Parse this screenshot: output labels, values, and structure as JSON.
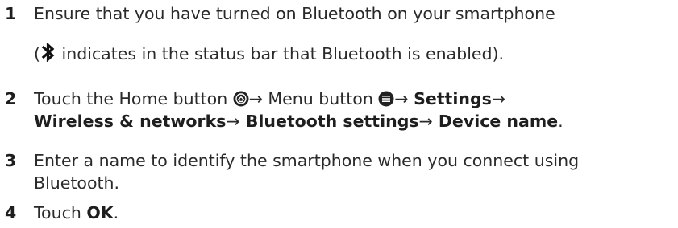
{
  "steps": [
    {
      "number": "1",
      "line1": "Ensure that you have turned on Bluetooth on your smartphone",
      "line2_open": "(",
      "line2_rest": " indicates in the status bar that Bluetooth is enabled)."
    },
    {
      "number": "2",
      "text_a": "Touch the Home button ",
      "arrow": "→",
      "text_b": " Menu button ",
      "settings": "Settings",
      "wireless": "Wireless & networks",
      "bt_settings": " Bluetooth settings",
      "device_name": " Device name",
      "period": "."
    },
    {
      "number": "3",
      "line1": "Enter a name to identify the smartphone when you connect using",
      "line2": "Bluetooth."
    },
    {
      "number": "4",
      "text": "Touch ",
      "ok": "OK",
      "period": "."
    }
  ],
  "icons": {
    "bluetooth": "bluetooth-icon",
    "home": "home-button-icon",
    "menu": "menu-button-icon"
  }
}
